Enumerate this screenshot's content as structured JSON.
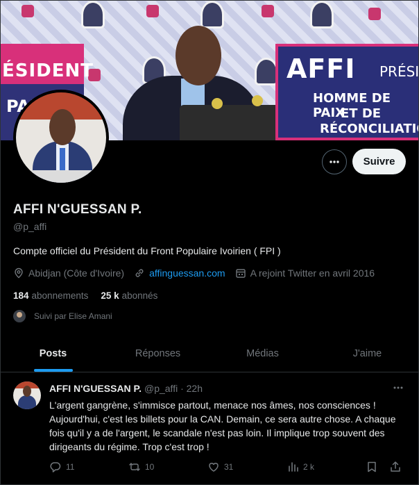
{
  "banner": {
    "sign_left_top": "ÉSIDENT",
    "sign_left_bottom": "PAI",
    "sign_right_affi": "AFFI",
    "sign_right_pres": "PRÉSID",
    "sign_right_line1": "HOMME DE PAIX",
    "sign_right_line2": "ET DE",
    "sign_right_line3": "RÉCONCILIATION"
  },
  "profile": {
    "name": "AFFI N'GUESSAN P.",
    "handle": "@p_affi",
    "bio": "Compte officiel du Président du Front Populaire Ivoirien ( FPI )",
    "location": "Abidjan (Côte d'Ivoire)",
    "website": "affinguessan.com",
    "joined": "A rejoint Twitter en avril 2016",
    "following_count": "184",
    "following_label": "abonnements",
    "followers_count": "25 k",
    "followers_label": "abonnés",
    "followed_by": "Suivi par Elise Amani"
  },
  "actions": {
    "follow_label": "Suivre"
  },
  "tabs": [
    {
      "label": "Posts",
      "active": true
    },
    {
      "label": "Réponses",
      "active": false
    },
    {
      "label": "Médias",
      "active": false
    },
    {
      "label": "J'aime",
      "active": false
    }
  ],
  "tweet": {
    "name": "AFFI N'GUESSAN P.",
    "handle_time": "@p_affi · 22h",
    "text": "L'argent gangrène, s'immisce partout, menace nos âmes, nos consciences ! Aujourd'hui, c'est les billets pour la CAN. Demain, ce sera autre chose. A chaque fois qu'il y a de l'argent, le scandale n'est pas loin. Il implique trop souvent des dirigeants du régime. Trop c'est trop !",
    "replies": "11",
    "reposts": "10",
    "likes": "31",
    "views": "2 k"
  },
  "colors": {
    "accent": "#1d9bf0",
    "muted": "#71767b",
    "text": "#e7e9ea",
    "background": "#000000"
  }
}
